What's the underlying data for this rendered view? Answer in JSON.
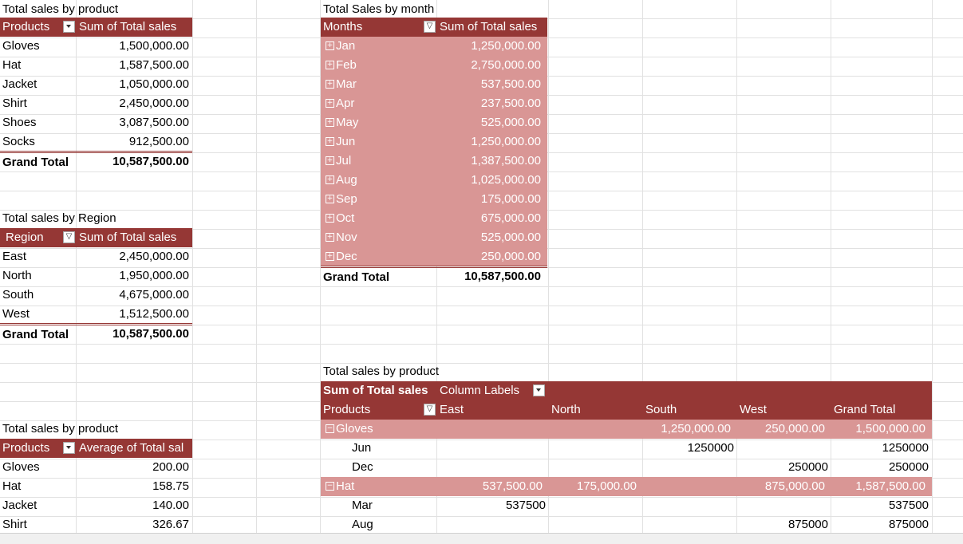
{
  "pivot_product": {
    "title": "Total sales by product",
    "col1": "Products",
    "col2": "Sum of Total sales",
    "rows": [
      {
        "label": "Gloves",
        "value": "1,500,000.00"
      },
      {
        "label": "Hat",
        "value": "1,587,500.00"
      },
      {
        "label": "Jacket",
        "value": "1,050,000.00"
      },
      {
        "label": "Shirt",
        "value": "2,450,000.00"
      },
      {
        "label": "Shoes",
        "value": "3,087,500.00"
      },
      {
        "label": "Socks",
        "value": "912,500.00"
      }
    ],
    "total_label": "Grand Total",
    "total_value": "10,587,500.00"
  },
  "pivot_region": {
    "title": "Total sales by Region",
    "col1": "Region",
    "col2": "Sum of Total sales",
    "rows": [
      {
        "label": "East",
        "value": "2,450,000.00"
      },
      {
        "label": "North",
        "value": "1,950,000.00"
      },
      {
        "label": "South",
        "value": "4,675,000.00"
      },
      {
        "label": "West",
        "value": "1,512,500.00"
      }
    ],
    "total_label": "Grand Total",
    "total_value": "10,587,500.00"
  },
  "pivot_avg": {
    "title": "Total sales by product",
    "col1": "Products",
    "col2": "Average of Total sal",
    "rows": [
      {
        "label": "Gloves",
        "value": "200.00"
      },
      {
        "label": "Hat",
        "value": "158.75"
      },
      {
        "label": "Jacket",
        "value": "140.00"
      },
      {
        "label": "Shirt",
        "value": "326.67"
      }
    ]
  },
  "pivot_month": {
    "title": "Total Sales by month",
    "col1": "Months",
    "col2": "Sum of Total sales",
    "rows": [
      {
        "label": "Jan",
        "value": "1,250,000.00"
      },
      {
        "label": "Feb",
        "value": "2,750,000.00"
      },
      {
        "label": "Mar",
        "value": "537,500.00"
      },
      {
        "label": "Apr",
        "value": "237,500.00"
      },
      {
        "label": "May",
        "value": "525,000.00"
      },
      {
        "label": "Jun",
        "value": "1,250,000.00"
      },
      {
        "label": "Jul",
        "value": "1,387,500.00"
      },
      {
        "label": "Aug",
        "value": "1,025,000.00"
      },
      {
        "label": "Sep",
        "value": "175,000.00"
      },
      {
        "label": "Oct",
        "value": "675,000.00"
      },
      {
        "label": "Nov",
        "value": "525,000.00"
      },
      {
        "label": "Dec",
        "value": "250,000.00"
      }
    ],
    "total_label": "Grand Total",
    "total_value": "10,587,500.00"
  },
  "pivot_cross": {
    "title": "Total sales by product",
    "value_header": "Sum of Total sales",
    "column_labels": "Column Labels",
    "row_header": "Products",
    "columns": [
      "East",
      "North",
      "South",
      "West",
      "Grand Total"
    ],
    "groups": [
      {
        "label": "Gloves",
        "values": [
          "",
          "",
          "1,250,000.00",
          "250,000.00",
          "1,500,000.00"
        ],
        "children": [
          {
            "label": "Jun",
            "values": [
              "",
              "",
              "1250000",
              "",
              "1250000"
            ]
          },
          {
            "label": "Dec",
            "values": [
              "",
              "",
              "",
              "250000",
              "250000"
            ]
          }
        ]
      },
      {
        "label": "Hat",
        "values": [
          "537,500.00",
          "175,000.00",
          "",
          "875,000.00",
          "1,587,500.00"
        ],
        "children": [
          {
            "label": "Mar",
            "values": [
              "537500",
              "",
              "",
              "",
              "537500"
            ]
          },
          {
            "label": "Aug",
            "values": [
              "",
              "",
              "",
              "875000",
              "875000"
            ]
          }
        ]
      }
    ]
  },
  "colors": {
    "header": "#953735",
    "band": "#d99695"
  }
}
